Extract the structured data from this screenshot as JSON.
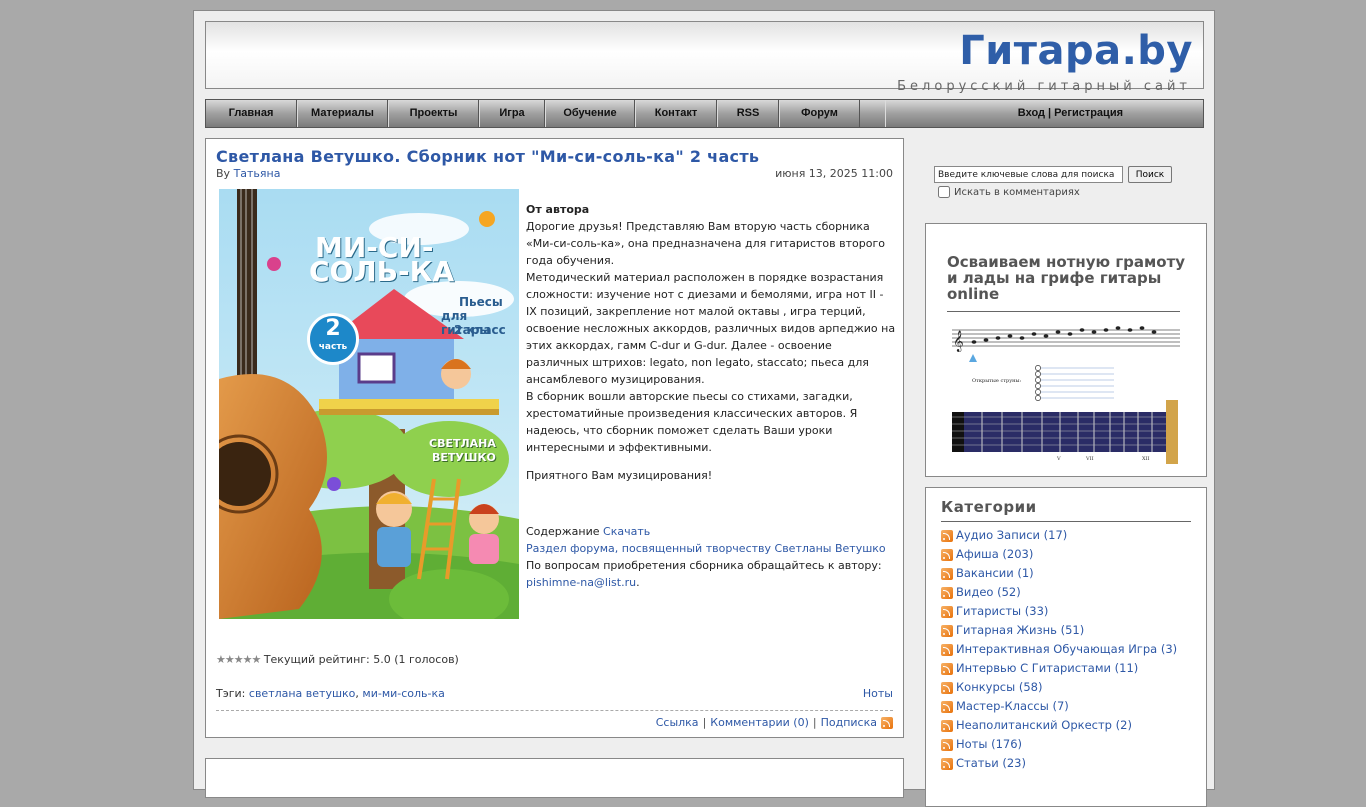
{
  "header": {
    "site_title": "Гитара.by",
    "tagline": "Белорусский гитарный сайт"
  },
  "nav": {
    "items": [
      {
        "label": "Главная"
      },
      {
        "label": "Материалы"
      },
      {
        "label": "Проекты"
      },
      {
        "label": "Игра"
      },
      {
        "label": "Обучение"
      },
      {
        "label": "Контакт"
      },
      {
        "label": "RSS"
      },
      {
        "label": "Форум"
      }
    ],
    "login": "Вход | Регистрация"
  },
  "post": {
    "title": "Светлана Ветушко. Сборник нот \"Ми-си-соль-ка\" 2 часть",
    "by": "By",
    "author": "Татьяна",
    "date": "июня 13, 2025 11:00",
    "cover": {
      "title_line1": "МИ-СИ-",
      "title_line2": "СОЛЬ-КА",
      "subtitle_line1": "Пьесы",
      "subtitle_line2": "для гитары",
      "subtitle_line3": "2 класс",
      "part_number": "2",
      "part_word": "часть",
      "author_line1": "СВЕТЛАНА",
      "author_line2": "ВЕТУШКО"
    },
    "from_author": "От автора",
    "paragraphs": [
      "Дорогие друзья! Представляю Вам вторую часть сборника «Ми-си-соль-ка», она предназначена для гитаристов второго года обучения.",
      "Методический материал расположен в порядке возрастания сложности: изучение нот с диезами и бемолями, игра нот II - IX позиций, закрепление нот малой октавы , игра терций, освоение несложных аккордов, различных видов арпеджио на этих аккордах, гамм C-dur и G-dur. Далее - освоение различных штрихов: legato, non legato, staccato; пьеса для ансамблевого музицирования.",
      "В сборник вошли авторские пьесы со стихами, загадки, хрестоматийные произведения классических авторов. Я надеюсь, что сборник поможет сделать Ваши уроки интересными и эффективными."
    ],
    "closing": "Приятного Вам музицирования!",
    "contents_label": "Содержание",
    "download_link": "Скачать",
    "forum_link": "Раздел форума, посвященный творчеству Светланы Ветушко",
    "purchase_text": "По вопросам приобретения сборника обращайтесь к автору:",
    "email": "pishimne-na@list.ru",
    "rating": {
      "stars": "★★★★★",
      "label": "Текущий рейтинг: 5.0 (1 голосов)",
      "value": 5.0,
      "max": 5
    },
    "tags_label": "Тэги:",
    "tags": [
      "светлана ветушко",
      "ми-ми-соль-ка"
    ],
    "category": "Ноты",
    "footer": {
      "link": "Ссылка",
      "comments": "Комментарии (0)",
      "subscribe": "Подписка"
    }
  },
  "sidebar": {
    "search": {
      "placeholder": "Введите ключевые слова для поиска",
      "button": "Поиск",
      "in_comments": "Искать в комментариях"
    },
    "promo": {
      "title": "Осваиваем нотную грамоту и лады на грифе гитары online",
      "strings_label": "Открытые струны:",
      "fret_marks": [
        "V",
        "VII",
        "XII"
      ]
    },
    "categories": {
      "title": "Категории",
      "items": [
        "Аудио Записи (17)",
        "Афиша (203)",
        "Вакансии (1)",
        "Видео (52)",
        "Гитаристы (33)",
        "Гитарная Жизнь (51)",
        "Интерактивная Обучающая Игра (3)",
        "Интервью С Гитаристами (11)",
        "Конкурсы (58)",
        "Мастер-Классы (7)",
        "Неаполитанский Оркестр (2)",
        "Ноты (176)",
        "Статьи (23)"
      ]
    }
  },
  "colors": {
    "link": "#2e58a6",
    "title": "#2f5ea8",
    "page_bg": "#a9a9a9",
    "rss": "#e8720c"
  }
}
